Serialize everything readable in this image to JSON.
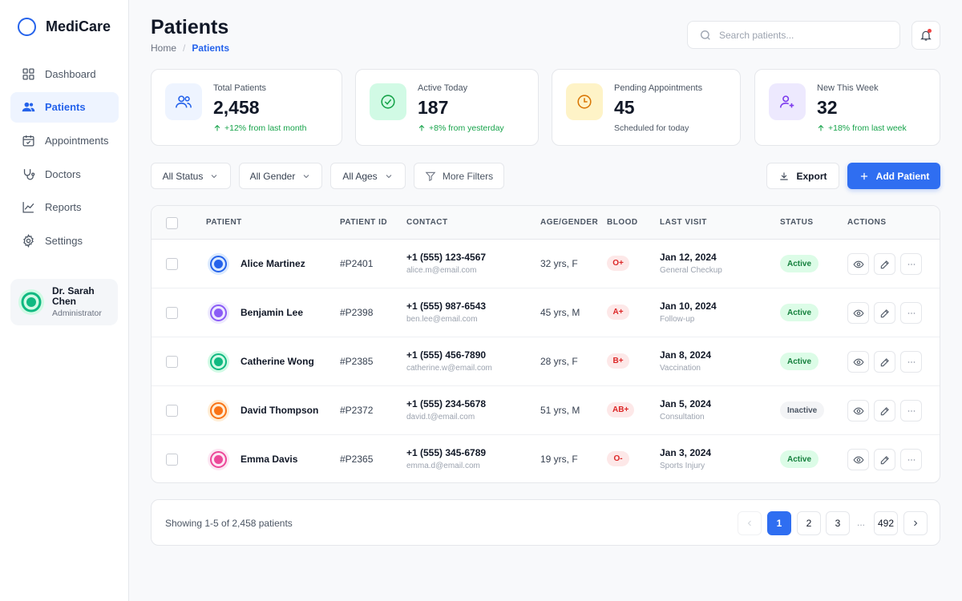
{
  "app": {
    "name": "MediCare"
  },
  "sidebar": {
    "items": [
      {
        "label": "Dashboard",
        "icon": "grid-icon"
      },
      {
        "label": "Patients",
        "icon": "users-icon",
        "active": true
      },
      {
        "label": "Appointments",
        "icon": "calendar-check-icon"
      },
      {
        "label": "Doctors",
        "icon": "stethoscope-icon"
      },
      {
        "label": "Reports",
        "icon": "line-chart-icon"
      },
      {
        "label": "Settings",
        "icon": "gear-icon"
      }
    ],
    "user": {
      "name_line1": "Dr. Sarah",
      "name_line2": "Chen",
      "role": "Administrator"
    }
  },
  "header": {
    "title": "Patients",
    "breadcrumb": {
      "home": "Home",
      "separator": "/",
      "current": "Patients"
    },
    "search_placeholder": "Search patients..."
  },
  "stats": [
    {
      "label": "Total Patients",
      "value": "2,458",
      "sub": "+12% from last month",
      "trend": "up",
      "icon": "users-icon",
      "icon_bg": "#eef4ff",
      "icon_color": "#2563eb"
    },
    {
      "label": "Active Today",
      "value": "187",
      "sub": "+8% from yesterday",
      "trend": "up",
      "icon": "check-circle-icon",
      "icon_bg": "#d1fae5",
      "icon_color": "#16a34a"
    },
    {
      "label": "Pending Appointments",
      "value": "45",
      "sub": "Scheduled for today",
      "trend": "none",
      "icon": "clock-icon",
      "icon_bg": "#fef3c7",
      "icon_color": "#d97706"
    },
    {
      "label": "New This Week",
      "value": "32",
      "sub": "+18% from last week",
      "trend": "up",
      "icon": "user-plus-icon",
      "icon_bg": "#ede9fe",
      "icon_color": "#7c3aed"
    }
  ],
  "filters": {
    "status": "All Status",
    "gender": "All Gender",
    "ages": "All Ages",
    "more": "More Filters",
    "export": "Export",
    "add": "Add Patient"
  },
  "table": {
    "columns": [
      "PATIENT",
      "PATIENT ID",
      "CONTACT",
      "AGE/GENDER",
      "BLOOD",
      "LAST VISIT",
      "STATUS",
      "ACTIONS"
    ],
    "rows": [
      {
        "name": "Alice Martinez",
        "id": "#P2401",
        "phone": "+1 (555) 123-4567",
        "email": "alice.m@email.com",
        "age_gender": "32 yrs, F",
        "blood": "O+",
        "visit_date": "Jan 12, 2024",
        "visit_type": "General Checkup",
        "status": "Active",
        "avatar_color": "#2563eb",
        "avatar_bg": "#dbeafe"
      },
      {
        "name": "Benjamin Lee",
        "id": "#P2398",
        "phone": "+1 (555) 987-6543",
        "email": "ben.lee@email.com",
        "age_gender": "45 yrs, M",
        "blood": "A+",
        "visit_date": "Jan 10, 2024",
        "visit_type": "Follow-up",
        "status": "Active",
        "avatar_color": "#8b5cf6",
        "avatar_bg": "#ede9fe"
      },
      {
        "name": "Catherine Wong",
        "id": "#P2385",
        "phone": "+1 (555) 456-7890",
        "email": "catherine.w@email.com",
        "age_gender": "28 yrs, F",
        "blood": "B+",
        "visit_date": "Jan 8, 2024",
        "visit_type": "Vaccination",
        "status": "Active",
        "avatar_color": "#10b981",
        "avatar_bg": "#d1fae5"
      },
      {
        "name": "David Thompson",
        "id": "#P2372",
        "phone": "+1 (555) 234-5678",
        "email": "david.t@email.com",
        "age_gender": "51 yrs, M",
        "blood": "AB+",
        "visit_date": "Jan 5, 2024",
        "visit_type": "Consultation",
        "status": "Inactive",
        "avatar_color": "#f97316",
        "avatar_bg": "#ffedd5"
      },
      {
        "name": "Emma Davis",
        "id": "#P2365",
        "phone": "+1 (555) 345-6789",
        "email": "emma.d@email.com",
        "age_gender": "19 yrs, F",
        "blood": "O-",
        "visit_date": "Jan 3, 2024",
        "visit_type": "Sports Injury",
        "status": "Active",
        "avatar_color": "#ec4899",
        "avatar_bg": "#fce7f3"
      }
    ]
  },
  "pagination": {
    "showing": "Showing 1-5 of 2,458 patients",
    "pages": [
      "1",
      "2",
      "3"
    ],
    "ellipsis": "...",
    "last": "492",
    "current": "1"
  },
  "colors": {
    "accent": "#2f6ef1",
    "active_status": "#15803d",
    "blood_badge": "#dc2626"
  }
}
